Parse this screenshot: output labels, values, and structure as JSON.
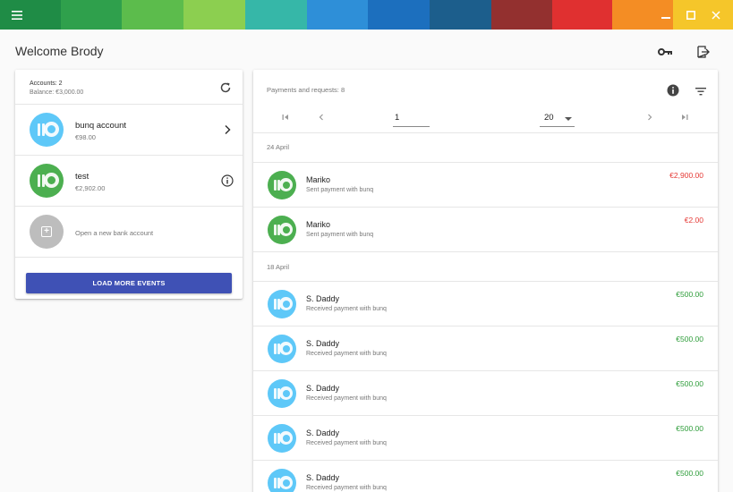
{
  "titlebar": {
    "stripes": [
      "#1f8c46",
      "#2fa04c",
      "#5cbc4c",
      "#8ccf50",
      "#36b7a8",
      "#2e8fd8",
      "#1c6fbe",
      "#1c5e8c",
      "#93302f",
      "#e03030",
      "#f48d24",
      "#f5c62a"
    ],
    "menu_icon": "hamburger-menu-icon",
    "minimize_icon": "minimize-icon",
    "maximize_icon": "maximize-icon",
    "close_icon": "close-icon"
  },
  "header": {
    "title": "Welcome Brody",
    "key_icon": "key-icon",
    "logout_icon": "logout-icon"
  },
  "accounts": {
    "count_label": "Accounts: 2",
    "balance_label": "Balance: €3,000.00",
    "refresh_icon": "refresh-icon",
    "items": [
      {
        "name": "bunq account",
        "balance": "€98.00",
        "color": "blue",
        "action_icon": "chevron-right-icon"
      },
      {
        "name": "test",
        "balance": "€2,902.00",
        "color": "green",
        "action_icon": "info-outline-icon"
      }
    ],
    "new_account_label": "Open a new bank account",
    "load_more_label": "LOAD MORE EVENTS"
  },
  "payments": {
    "count_label": "Payments and requests: 8",
    "info_icon": "info-icon",
    "filter_icon": "filter-icon",
    "pager": {
      "page_value": "1",
      "page_size": "20",
      "first_icon": "first-page-icon",
      "prev_icon": "previous-page-icon",
      "next_icon": "next-page-icon",
      "last_icon": "last-page-icon"
    },
    "groups": [
      {
        "date": "24 April",
        "items": [
          {
            "name": "Mariko",
            "description": "Sent payment with bunq",
            "amount": "€2,900.00",
            "direction": "negative",
            "color": "green"
          },
          {
            "name": "Mariko",
            "description": "Sent payment with bunq",
            "amount": "€2.00",
            "direction": "negative",
            "color": "green"
          }
        ]
      },
      {
        "date": "18 April",
        "items": [
          {
            "name": "S. Daddy",
            "description": "Received payment with bunq",
            "amount": "€500.00",
            "direction": "positive",
            "color": "blue"
          },
          {
            "name": "S. Daddy",
            "description": "Received payment with bunq",
            "amount": "€500.00",
            "direction": "positive",
            "color": "blue"
          },
          {
            "name": "S. Daddy",
            "description": "Received payment with bunq",
            "amount": "€500.00",
            "direction": "positive",
            "color": "blue"
          },
          {
            "name": "S. Daddy",
            "description": "Received payment with bunq",
            "amount": "€500.00",
            "direction": "positive",
            "color": "blue"
          },
          {
            "name": "S. Daddy",
            "description": "Received payment with bunq",
            "amount": "€500.00",
            "direction": "positive",
            "color": "blue"
          }
        ]
      }
    ]
  }
}
